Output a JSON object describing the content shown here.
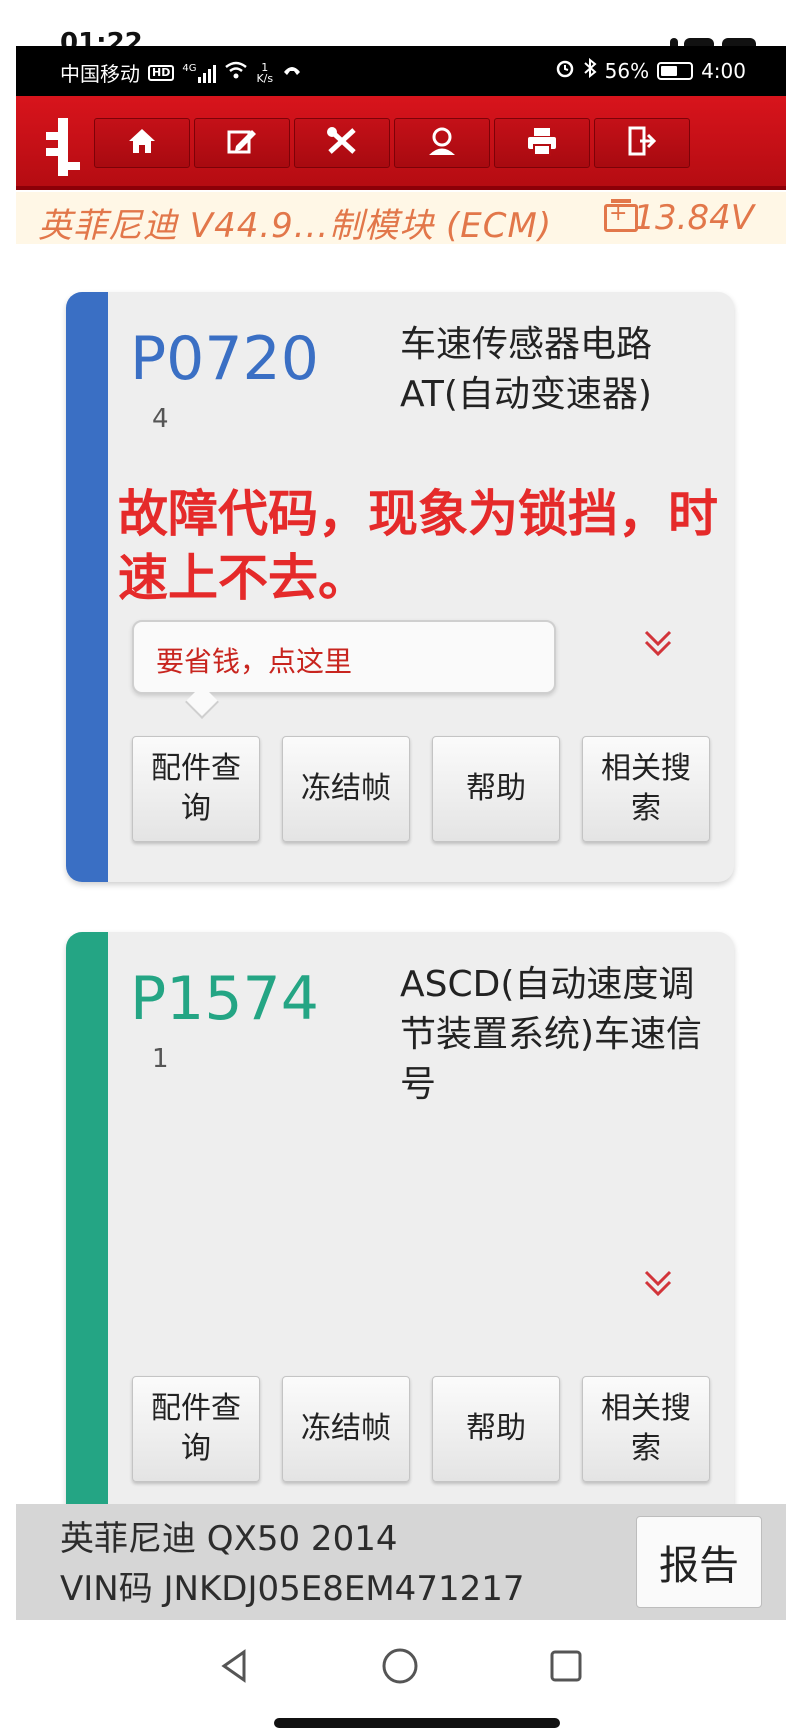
{
  "outer_status": {
    "time": "01:22"
  },
  "status_bar": {
    "carrier": "中国移动",
    "hd_badge": "HD",
    "network": "4G",
    "speed_value": "1",
    "speed_unit": "K/s",
    "battery_percent": "56%",
    "time": "4:00"
  },
  "toolbar": {
    "buttons": [
      {
        "icon": "home-icon"
      },
      {
        "icon": "edit-icon"
      },
      {
        "icon": "tools-icon"
      },
      {
        "icon": "support-icon"
      },
      {
        "icon": "print-icon"
      },
      {
        "icon": "exit-icon"
      }
    ]
  },
  "module": {
    "title": "英菲尼迪 V44.9...制模块 (ECM)",
    "voltage": "13.84V"
  },
  "dtc_cards": [
    {
      "code": "P0720",
      "count": "4",
      "description": "车速传感器电路 AT(自动变速器)",
      "stripe_color": "#3a6fc4",
      "code_color": "#3a6fc4",
      "annotation": "故障代码，现象为锁挡，时速上不去。",
      "tip": "要省钱，点这里",
      "buttons": [
        "配件查询",
        "冻结帧",
        "帮助",
        "相关搜索"
      ]
    },
    {
      "code": "P1574",
      "count": "1",
      "description": "ASCD(自动速度调节装置系统)车速信号",
      "stripe_color": "#24a584",
      "code_color": "#24a584",
      "buttons": [
        "配件查询",
        "冻结帧",
        "帮助",
        "相关搜索"
      ]
    }
  ],
  "footer": {
    "vehicle": "英菲尼迪 QX50 2014",
    "vin": "VIN码 JNKDJ05E8EM471217",
    "report_label": "报告"
  },
  "colors": {
    "toolbar_red": "#c8121a",
    "module_text": "#e2774a",
    "annotation_red": "#e52a2a"
  }
}
